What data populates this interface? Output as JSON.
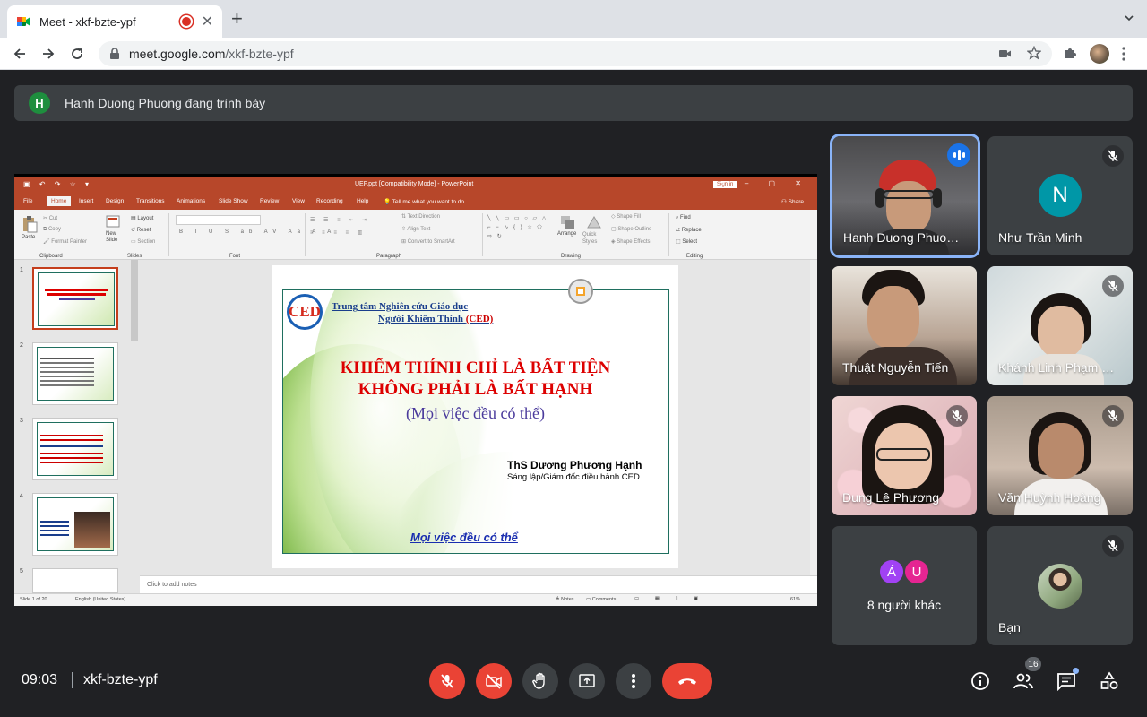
{
  "browser": {
    "tab_title": "Meet - xkf-bzte-ypf",
    "url_host": "meet.google.com",
    "url_path": "/xkf-bzte-ypf"
  },
  "presenting": {
    "avatar_letter": "H",
    "text": "Hanh Duong Phuong đang trình bày"
  },
  "powerpoint": {
    "window_title": "UEF.ppt [Compatibility Mode] - PowerPoint",
    "sign_in": "Sign in",
    "tabs": [
      "File",
      "Home",
      "Insert",
      "Design",
      "Transitions",
      "Animations",
      "Slide Show",
      "Review",
      "View",
      "Recording",
      "Help"
    ],
    "tell_me": "Tell me what you want to do",
    "share": "Share",
    "ribbon": {
      "paste": "Paste",
      "cut": "Cut",
      "copy": "Copy",
      "format_painter": "Format Painter",
      "clipboard": "Clipboard",
      "new_slide": "New Slide",
      "layout": "Layout",
      "reset": "Reset",
      "section": "Section",
      "slides": "Slides",
      "font": "Font",
      "text_direction": "Text Direction",
      "align_text": "Align Text",
      "convert_smartart": "Convert to SmartArt",
      "paragraph": "Paragraph",
      "arrange": "Arrange",
      "quick_styles": "Quick Styles",
      "shape_fill": "Shape Fill",
      "shape_outline": "Shape Outline",
      "shape_effects": "Shape Effects",
      "drawing": "Drawing",
      "find": "Find",
      "replace": "Replace",
      "select": "Select",
      "editing": "Editing"
    },
    "thumb_numbers": [
      "1",
      "2",
      "3",
      "4",
      "5"
    ],
    "notes_placeholder": "Click to add notes",
    "status_slide": "Slide 1 of 20",
    "status_lang": "English (United States)",
    "status_notes": "Notes",
    "status_comments": "Comments",
    "zoom": "61%",
    "slide": {
      "org_line1": "Trung tâm Nghiên cứu Giáo dục",
      "org_line2": "Người Khiếm Thính",
      "org_ced": "(CED)",
      "title_line1": "KHIẾM THÍNH CHỈ LÀ BẤT TIỆN",
      "title_line2": "KHÔNG PHẢI LÀ BẤT HẠNH",
      "subtitle": "(Mọi việc đều có thể)",
      "author": "ThS Dương Phương Hạnh",
      "role": "Sáng lập/Giám đốc điều hành CED",
      "motto": "Mọi việc đều có thể"
    }
  },
  "participants": [
    {
      "name": "Hanh Duong Phuo…",
      "speaking": true
    },
    {
      "name": "Như Trần Minh",
      "initial": "N",
      "avatar_color": "#0097a7"
    },
    {
      "name": "Thuật Nguyễn Tiến"
    },
    {
      "name": "Khánh Linh Phạm …"
    },
    {
      "name": "Dung Lê Phương"
    },
    {
      "name": "Văn Huỳnh Hoàng"
    },
    {
      "name": "8 người khác",
      "avatars": [
        "Á",
        "U"
      ]
    },
    {
      "name": "Bạn"
    }
  ],
  "bottom": {
    "time": "09:03",
    "meeting_code": "xkf-bzte-ypf",
    "people_count": "16"
  },
  "colors": {
    "meet_bg": "#202124",
    "tile_bg": "#3c4043",
    "danger": "#ea4335",
    "ppt_accent": "#b7472a",
    "active_speaker": "#8ab4f8"
  }
}
